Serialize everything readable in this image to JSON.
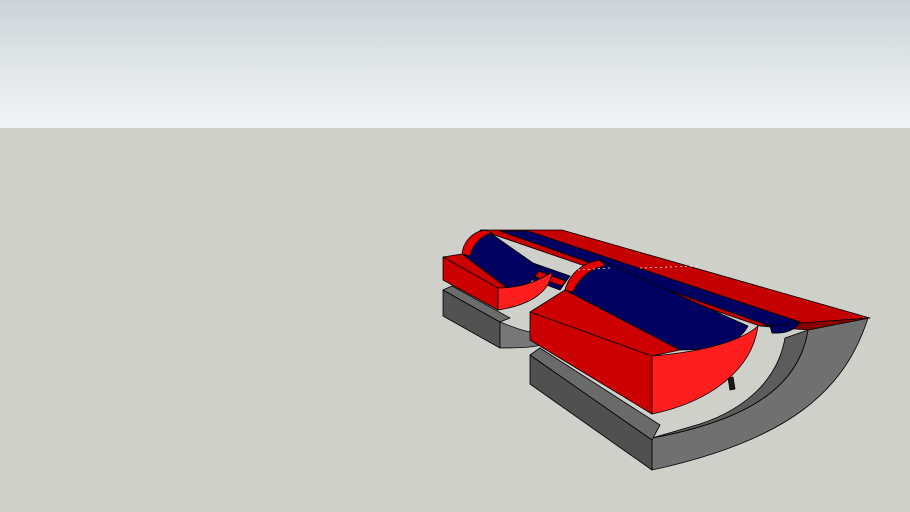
{
  "scene": {
    "colors": {
      "sky_top": "#ccd4d8",
      "sky_bottom": "#f1f3f4",
      "ground": "#d0d0cb",
      "red_dark": "#cc0000",
      "red_top": "#c40000",
      "red_bright": "#ff1e1e",
      "navy": "#000060",
      "gray_face": "#6e6e6e",
      "gray_dark": "#4a4a4a",
      "edge": "#000000"
    },
    "objects": [
      "red-half-pipe-module",
      "gray-base-platform"
    ]
  }
}
